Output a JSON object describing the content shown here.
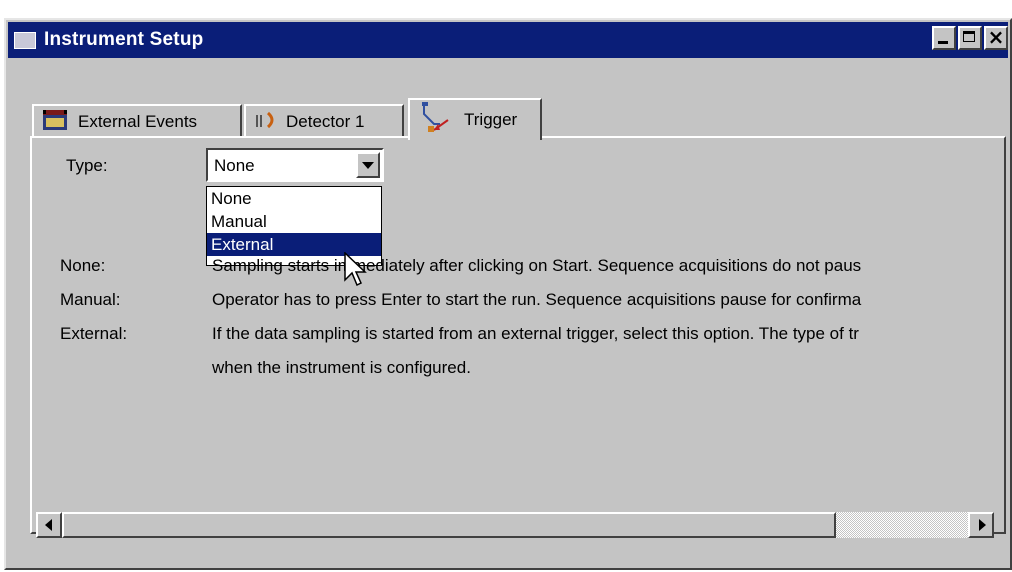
{
  "window": {
    "title": "Instrument Setup",
    "controls": {
      "minimize": "minimize",
      "maximize": "maximize",
      "close": "×"
    }
  },
  "tabs": [
    {
      "label": "External Events",
      "icon": "calendar-icon",
      "active": false
    },
    {
      "label": "Detector 1",
      "icon": "detector-icon",
      "active": false
    },
    {
      "label": "Trigger",
      "icon": "trigger-icon",
      "active": true
    }
  ],
  "trigger": {
    "type_label": "Type:",
    "selected_value": "None",
    "options": [
      "None",
      "Manual",
      "External"
    ],
    "highlighted_option": "External"
  },
  "descriptions": [
    {
      "term": "None:",
      "text": "Sampling starts immediately after clicking on Start.  Sequence acquisitions do not paus"
    },
    {
      "term": "Manual:",
      "text": "Operator has to press Enter to start the run.  Sequence acquisitions pause for confirma"
    },
    {
      "term": "External:",
      "text": "If the data sampling is started from an external trigger, select this option.  The type of tr"
    },
    {
      "term": "",
      "text": "when the instrument is configured."
    }
  ],
  "colors": {
    "title_bar": "#0a1e78",
    "window_bg": "#c4c4c4",
    "selection": "#0a1e78"
  }
}
